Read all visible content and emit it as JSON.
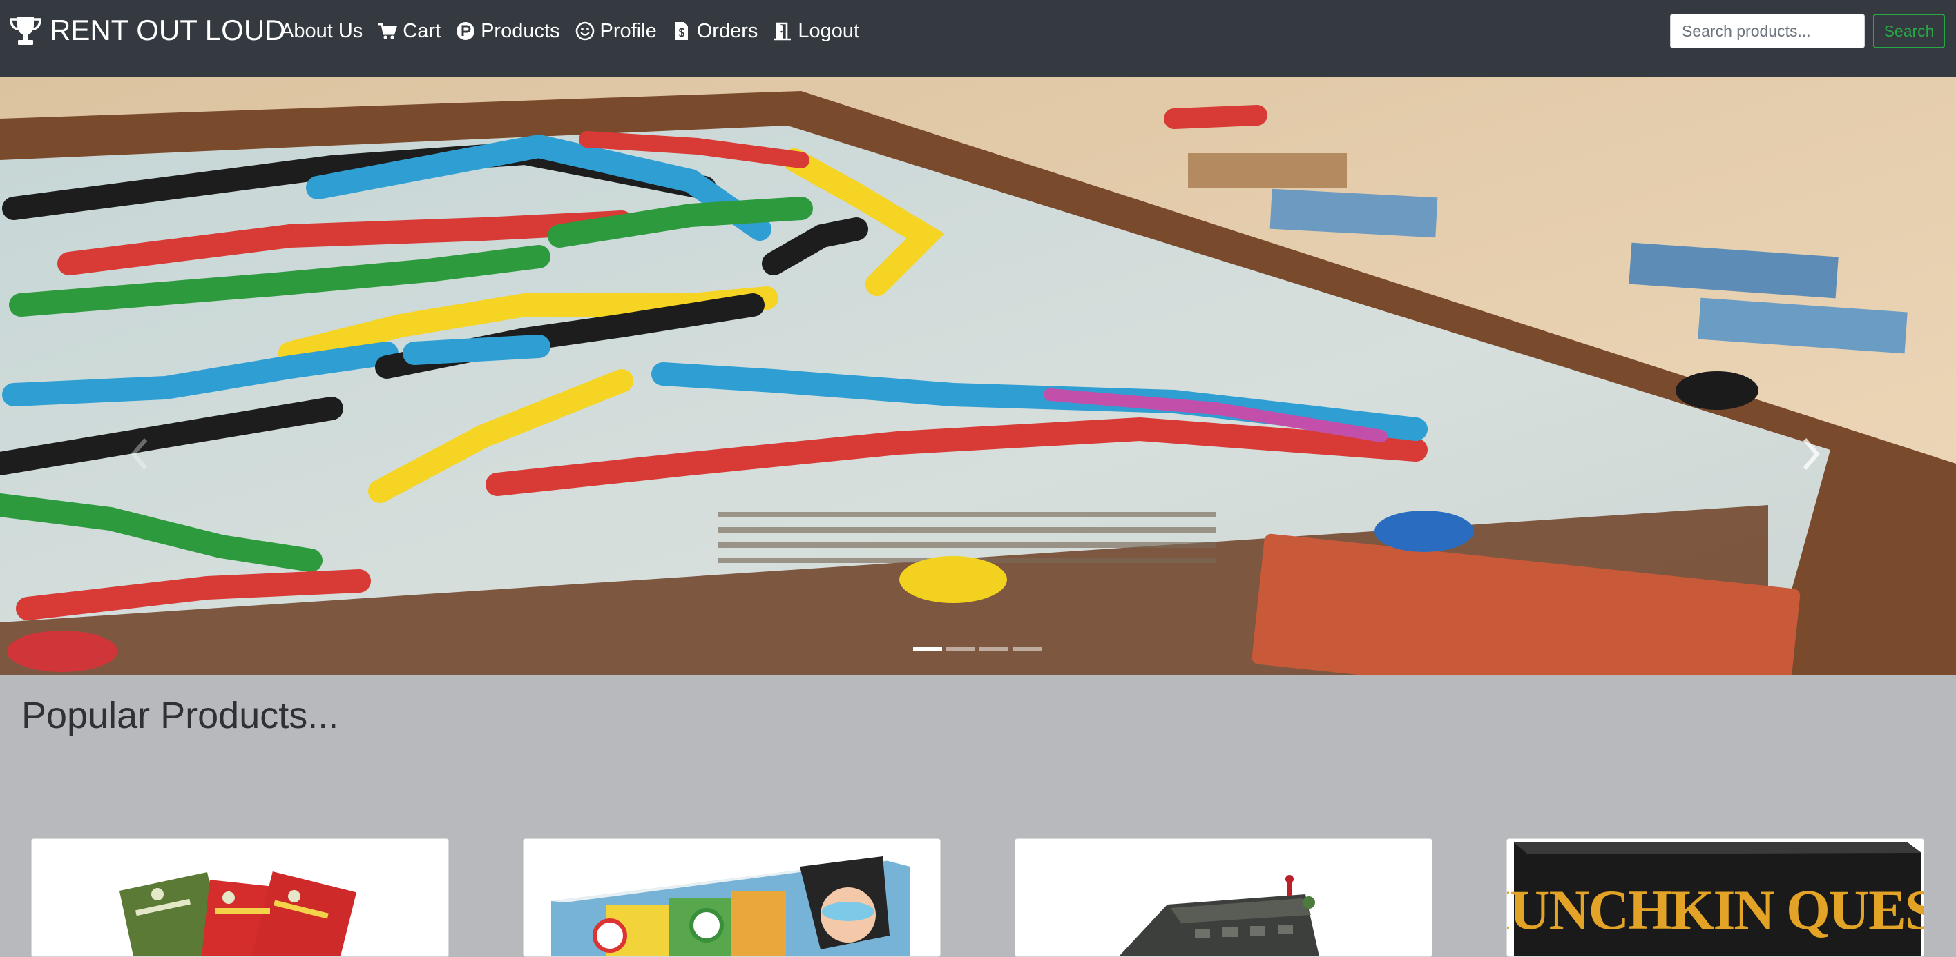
{
  "navbar": {
    "brand": "RENT OUT LOUD",
    "brand_icon": "trophy-icon",
    "items": [
      {
        "label": "About Us",
        "icon": ""
      },
      {
        "label": "Cart",
        "icon": "cart-icon"
      },
      {
        "label": "Products",
        "icon": "product-p-icon"
      },
      {
        "label": "Profile",
        "icon": "smile-icon"
      },
      {
        "label": "Orders",
        "icon": "receipt-icon"
      },
      {
        "label": "Logout",
        "icon": "door-icon"
      }
    ],
    "search": {
      "placeholder": "Search products...",
      "button_label": "Search"
    }
  },
  "carousel": {
    "slide_count": 4,
    "active_index": 0,
    "image_subject": "board-game-photo"
  },
  "main": {
    "section_title": "Popular Products...",
    "products": [
      {
        "image": "card-game-box-photo"
      },
      {
        "image": "monopoly-box-photo"
      },
      {
        "image": "dark-board-game-photo"
      },
      {
        "image": "munchkin-quest-box-photo",
        "box_text": "MUNCHKIN QUEST"
      }
    ]
  },
  "colors": {
    "navbar_bg": "#343a40",
    "page_bg": "#b7b9bd",
    "search_accent": "#28a745"
  }
}
